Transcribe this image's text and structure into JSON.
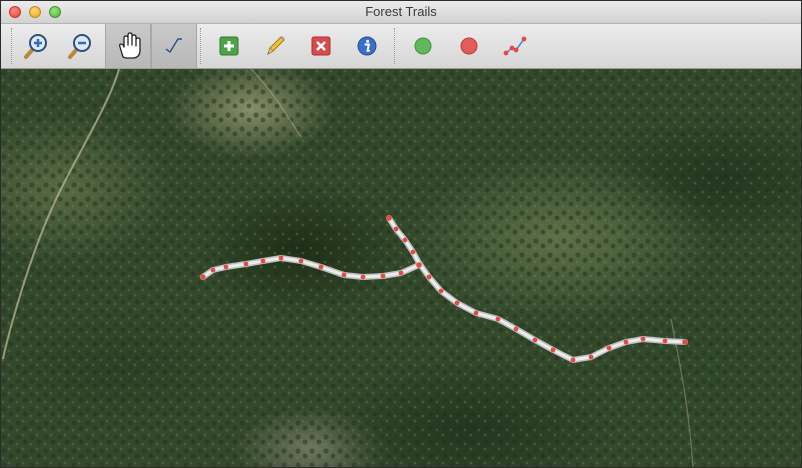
{
  "window": {
    "title": "Forest Trails"
  },
  "toolbar": {
    "tools": [
      {
        "icon": "zoom-in-icon",
        "active": false
      },
      {
        "icon": "zoom-out-icon",
        "active": false
      },
      {
        "icon": "pan-hand-icon",
        "active": true
      },
      {
        "icon": "draw-trail-icon",
        "active": true
      },
      {
        "icon": "add-icon",
        "active": false
      },
      {
        "icon": "pencil-icon",
        "active": false
      },
      {
        "icon": "delete-icon",
        "active": false
      },
      {
        "icon": "info-icon",
        "active": false
      },
      {
        "icon": "green-dot-icon",
        "active": false
      },
      {
        "icon": "red-dot-icon",
        "active": false
      },
      {
        "icon": "edit-vertices-icon",
        "active": false
      }
    ]
  },
  "colors": {
    "trail_line": "#e3e3e3",
    "trail_vertex": "#e24a4a",
    "add_green": "#4ea34a",
    "delete_red": "#d94b4b",
    "info_blue": "#3a6fc9",
    "green_dot": "#5fb85a",
    "red_dot": "#e45b5b"
  }
}
